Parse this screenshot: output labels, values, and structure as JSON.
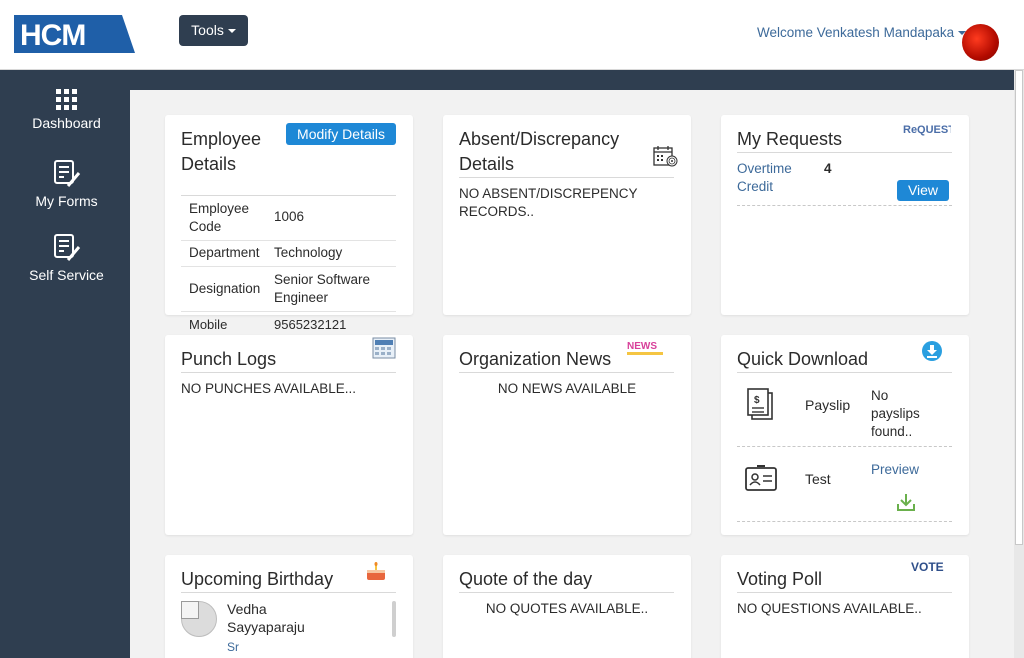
{
  "header": {
    "logo_text": "HCM",
    "tools_label": "Tools",
    "welcome_text": "Welcome Venkatesh Mandapaka"
  },
  "sidenav": {
    "items": [
      {
        "label": "Dashboard",
        "icon": "grid-icon"
      },
      {
        "label": "My Forms",
        "icon": "form-edit-icon"
      },
      {
        "label": "Self Service",
        "icon": "form-edit-icon"
      }
    ]
  },
  "employee": {
    "title": "Employee Details",
    "modify_label": "Modify Details",
    "rows": [
      {
        "label": "Employee Code",
        "value": "1006"
      },
      {
        "label": "Department",
        "value": "Technology"
      },
      {
        "label": "Designation",
        "value": "Senior Software Engineer"
      },
      {
        "label": "Mobile",
        "value": "9565232121"
      }
    ]
  },
  "absent": {
    "title": "Absent/Discrepancy Details",
    "message": "NO ABSENT/DISCREPENCY RECORDS.."
  },
  "requests": {
    "title": "My Requests",
    "badge_text": "ReQUEST",
    "item_label": "Overtime Credit",
    "item_count": "4",
    "view_label": "View"
  },
  "punch": {
    "title": "Punch Logs",
    "message": "NO PUNCHES AVAILABLE..."
  },
  "news": {
    "title": "Organization News",
    "badge_text": "NEWS",
    "message": "NO NEWS AVAILABLE"
  },
  "download": {
    "title": "Quick Download",
    "payslip_label": "Payslip",
    "payslip_status": "No payslips found..",
    "test_label": "Test",
    "preview_label": "Preview"
  },
  "birthday": {
    "title": "Upcoming Birthday",
    "name": "Vedha Sayyaparaju",
    "role": "Sr"
  },
  "quote": {
    "title": "Quote of the day",
    "message": "NO QUOTES AVAILABLE.."
  },
  "poll": {
    "title": "Voting Poll",
    "badge_text": "VOTE",
    "message": "NO QUESTIONS AVAILABLE.."
  },
  "colors": {
    "navy": "#2f3e50",
    "accent_blue": "#1e88d6",
    "link_blue": "#3d6a9a"
  }
}
